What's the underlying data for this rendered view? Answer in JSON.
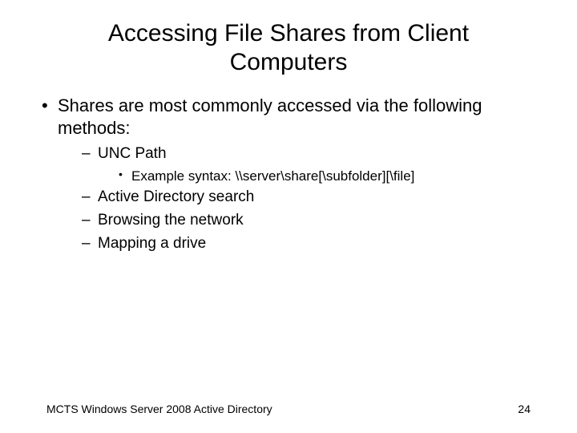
{
  "title": "Accessing File Shares from Client Computers",
  "bullets": {
    "l1_0": "Shares are most commonly accessed via the following methods:",
    "l2_0": "UNC Path",
    "l3_0": "Example syntax: \\\\server\\share[\\subfolder][\\file]",
    "l2_1": "Active Directory search",
    "l2_2": "Browsing the network",
    "l2_3": "Mapping a drive"
  },
  "footer": {
    "left": "MCTS Windows Server 2008 Active Directory",
    "right": "24"
  }
}
